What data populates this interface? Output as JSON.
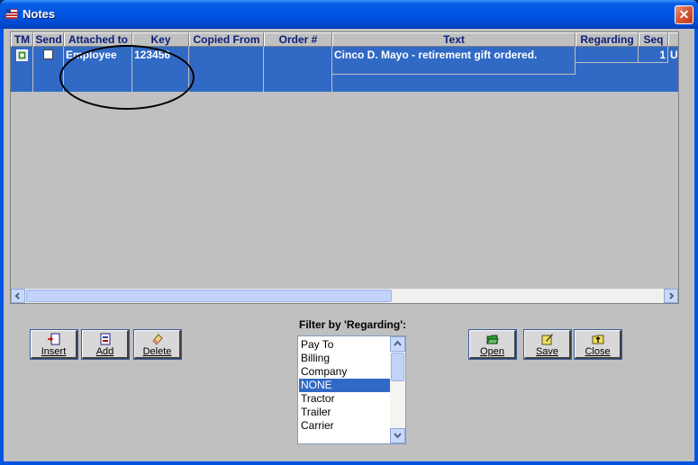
{
  "window": {
    "title": "Notes",
    "close_label": "✕"
  },
  "grid": {
    "columns": [
      "TM",
      "Send",
      "Attached to",
      "Key",
      "Copied From",
      "Order #",
      "Text",
      "Regarding",
      "Seq"
    ],
    "rows": [
      {
        "attached_to": "Employee",
        "key": "123456",
        "copied_from": "",
        "order": "",
        "text": "Cinco D. Mayo - retirement gift ordered.",
        "regarding": "",
        "seq": "1",
        "overflow": "Ul"
      }
    ]
  },
  "buttons": {
    "insert": "Insert",
    "add": "Add",
    "delete": "Delete",
    "open": "Open",
    "save": "Save",
    "close": "Close"
  },
  "filter": {
    "label": "Filter by 'Regarding':",
    "options": [
      "Pay To",
      "Billing",
      "Company",
      "NONE",
      "Tractor",
      "Trailer",
      "Carrier"
    ],
    "selected": "NONE"
  },
  "icons": {
    "app": "notes-app-icon",
    "tm": "tm-note-icon",
    "insert": "insert-icon",
    "add": "add-icon",
    "delete": "eraser-icon",
    "open": "open-folder-icon",
    "save": "save-pencil-icon",
    "close": "close-folder-icon"
  },
  "colors": {
    "selection": "#316ac5",
    "header_text": "#0a1e7a",
    "title_bar": "#0054e3"
  }
}
